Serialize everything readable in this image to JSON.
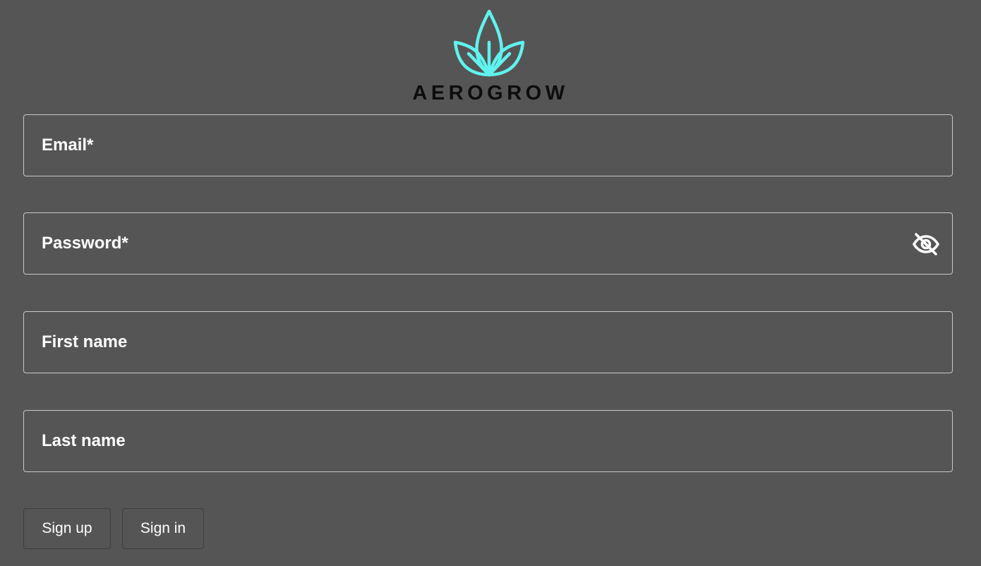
{
  "brand": {
    "name": "AEROGROW",
    "icon": "leaf-logo-icon",
    "icon_color": "#5ff3ee"
  },
  "form": {
    "email_placeholder": "Email*",
    "password_placeholder": "Password*",
    "password_toggle_icon": "eye-off-icon",
    "first_name_placeholder": "First name",
    "last_name_placeholder": "Last name"
  },
  "actions": {
    "sign_up_label": "Sign up",
    "sign_in_label": "Sign in"
  }
}
